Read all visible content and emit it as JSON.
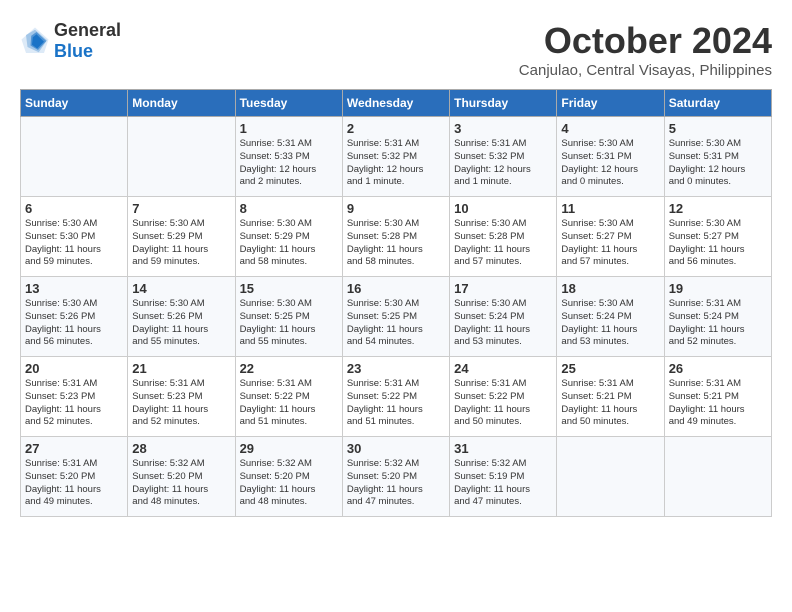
{
  "header": {
    "logo_general": "General",
    "logo_blue": "Blue",
    "month": "October 2024",
    "location": "Canjulao, Central Visayas, Philippines"
  },
  "days_of_week": [
    "Sunday",
    "Monday",
    "Tuesday",
    "Wednesday",
    "Thursday",
    "Friday",
    "Saturday"
  ],
  "weeks": [
    [
      {
        "day": "",
        "info": ""
      },
      {
        "day": "",
        "info": ""
      },
      {
        "day": "1",
        "info": "Sunrise: 5:31 AM\nSunset: 5:33 PM\nDaylight: 12 hours\nand 2 minutes."
      },
      {
        "day": "2",
        "info": "Sunrise: 5:31 AM\nSunset: 5:32 PM\nDaylight: 12 hours\nand 1 minute."
      },
      {
        "day": "3",
        "info": "Sunrise: 5:31 AM\nSunset: 5:32 PM\nDaylight: 12 hours\nand 1 minute."
      },
      {
        "day": "4",
        "info": "Sunrise: 5:30 AM\nSunset: 5:31 PM\nDaylight: 12 hours\nand 0 minutes."
      },
      {
        "day": "5",
        "info": "Sunrise: 5:30 AM\nSunset: 5:31 PM\nDaylight: 12 hours\nand 0 minutes."
      }
    ],
    [
      {
        "day": "6",
        "info": "Sunrise: 5:30 AM\nSunset: 5:30 PM\nDaylight: 11 hours\nand 59 minutes."
      },
      {
        "day": "7",
        "info": "Sunrise: 5:30 AM\nSunset: 5:29 PM\nDaylight: 11 hours\nand 59 minutes."
      },
      {
        "day": "8",
        "info": "Sunrise: 5:30 AM\nSunset: 5:29 PM\nDaylight: 11 hours\nand 58 minutes."
      },
      {
        "day": "9",
        "info": "Sunrise: 5:30 AM\nSunset: 5:28 PM\nDaylight: 11 hours\nand 58 minutes."
      },
      {
        "day": "10",
        "info": "Sunrise: 5:30 AM\nSunset: 5:28 PM\nDaylight: 11 hours\nand 57 minutes."
      },
      {
        "day": "11",
        "info": "Sunrise: 5:30 AM\nSunset: 5:27 PM\nDaylight: 11 hours\nand 57 minutes."
      },
      {
        "day": "12",
        "info": "Sunrise: 5:30 AM\nSunset: 5:27 PM\nDaylight: 11 hours\nand 56 minutes."
      }
    ],
    [
      {
        "day": "13",
        "info": "Sunrise: 5:30 AM\nSunset: 5:26 PM\nDaylight: 11 hours\nand 56 minutes."
      },
      {
        "day": "14",
        "info": "Sunrise: 5:30 AM\nSunset: 5:26 PM\nDaylight: 11 hours\nand 55 minutes."
      },
      {
        "day": "15",
        "info": "Sunrise: 5:30 AM\nSunset: 5:25 PM\nDaylight: 11 hours\nand 55 minutes."
      },
      {
        "day": "16",
        "info": "Sunrise: 5:30 AM\nSunset: 5:25 PM\nDaylight: 11 hours\nand 54 minutes."
      },
      {
        "day": "17",
        "info": "Sunrise: 5:30 AM\nSunset: 5:24 PM\nDaylight: 11 hours\nand 53 minutes."
      },
      {
        "day": "18",
        "info": "Sunrise: 5:30 AM\nSunset: 5:24 PM\nDaylight: 11 hours\nand 53 minutes."
      },
      {
        "day": "19",
        "info": "Sunrise: 5:31 AM\nSunset: 5:24 PM\nDaylight: 11 hours\nand 52 minutes."
      }
    ],
    [
      {
        "day": "20",
        "info": "Sunrise: 5:31 AM\nSunset: 5:23 PM\nDaylight: 11 hours\nand 52 minutes."
      },
      {
        "day": "21",
        "info": "Sunrise: 5:31 AM\nSunset: 5:23 PM\nDaylight: 11 hours\nand 52 minutes."
      },
      {
        "day": "22",
        "info": "Sunrise: 5:31 AM\nSunset: 5:22 PM\nDaylight: 11 hours\nand 51 minutes."
      },
      {
        "day": "23",
        "info": "Sunrise: 5:31 AM\nSunset: 5:22 PM\nDaylight: 11 hours\nand 51 minutes."
      },
      {
        "day": "24",
        "info": "Sunrise: 5:31 AM\nSunset: 5:22 PM\nDaylight: 11 hours\nand 50 minutes."
      },
      {
        "day": "25",
        "info": "Sunrise: 5:31 AM\nSunset: 5:21 PM\nDaylight: 11 hours\nand 50 minutes."
      },
      {
        "day": "26",
        "info": "Sunrise: 5:31 AM\nSunset: 5:21 PM\nDaylight: 11 hours\nand 49 minutes."
      }
    ],
    [
      {
        "day": "27",
        "info": "Sunrise: 5:31 AM\nSunset: 5:20 PM\nDaylight: 11 hours\nand 49 minutes."
      },
      {
        "day": "28",
        "info": "Sunrise: 5:32 AM\nSunset: 5:20 PM\nDaylight: 11 hours\nand 48 minutes."
      },
      {
        "day": "29",
        "info": "Sunrise: 5:32 AM\nSunset: 5:20 PM\nDaylight: 11 hours\nand 48 minutes."
      },
      {
        "day": "30",
        "info": "Sunrise: 5:32 AM\nSunset: 5:20 PM\nDaylight: 11 hours\nand 47 minutes."
      },
      {
        "day": "31",
        "info": "Sunrise: 5:32 AM\nSunset: 5:19 PM\nDaylight: 11 hours\nand 47 minutes."
      },
      {
        "day": "",
        "info": ""
      },
      {
        "day": "",
        "info": ""
      }
    ]
  ]
}
